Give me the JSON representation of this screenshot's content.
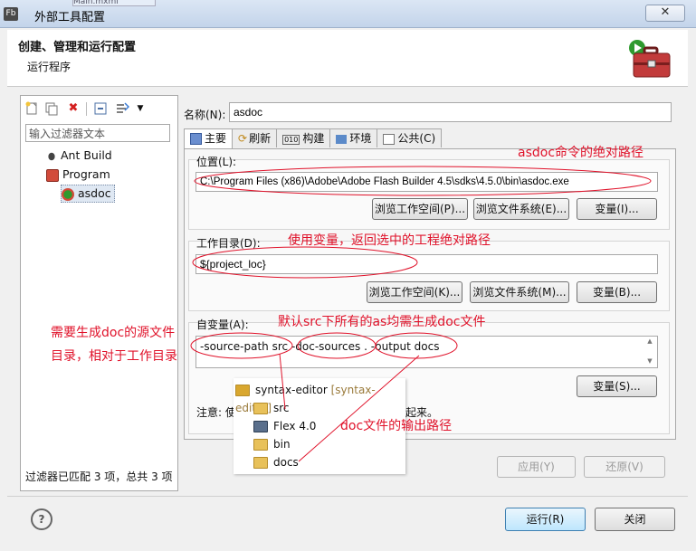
{
  "window": {
    "title": "外部工具配置",
    "app_icon": "Fb",
    "bg_tab": "Main.mxml",
    "close_glyph": "✕"
  },
  "banner": {
    "title": "创建、管理和运行配置",
    "subtitle": "运行程序",
    "icon": "toolbox-icon"
  },
  "left": {
    "filter_placeholder": "输入过滤器文本",
    "tree": [
      {
        "label": "Ant Build",
        "icon": "ant-icon"
      },
      {
        "label": "Program",
        "icon": "program-icon"
      },
      {
        "label": "asdoc",
        "icon": "program-config-icon",
        "selected": true
      }
    ],
    "status": "过滤器已匹配 3 项，总共 3 项"
  },
  "right": {
    "name_label": "名称(N):",
    "name_value": "asdoc",
    "tabs": [
      "主要",
      "刷新",
      "构建",
      "环境",
      "公共(C)"
    ],
    "location": {
      "label": "位置(L):",
      "value": "C:\\Program Files (x86)\\Adobe\\Adobe Flash Builder 4.5\\sdks\\4.5.0\\bin\\asdoc.exe",
      "btn_workspace": "浏览工作空间(P)...",
      "btn_filesystem": "浏览文件系统(E)...",
      "btn_variables": "变量(I)..."
    },
    "workdir": {
      "label": "工作目录(D):",
      "value": "${project_loc}",
      "btn_workspace": "浏览工作空间(K)...",
      "btn_filesystem": "浏览文件系统(M)...",
      "btn_variables": "变量(B)..."
    },
    "args": {
      "label": "自变量(A):",
      "value": "-source-path  src  -doc-sources  . -output docs",
      "btn_variables": "变量(S)...",
      "note_prefix": "注意: 使",
      "note_suffix": "起来。"
    },
    "apply": "应用(Y)",
    "revert": "还原(V)"
  },
  "popup": {
    "project": "syntax-editor",
    "project_tag": "[syntax-editor]",
    "items": [
      "src",
      "Flex 4.0",
      "bin",
      "docs"
    ]
  },
  "footer": {
    "run": "运行(R)",
    "close": "关闭"
  },
  "annotations": {
    "abs_path": "asdoc命令的绝对路径",
    "var_note": "使用变量，返回选中的工程绝对路径",
    "src_note": "默认src下所有的as均需生成doc文件",
    "left_note_1": "需要生成doc的源文件",
    "left_note_2": "目录，相对于工作目录",
    "output_note": "doc文件的输出路径",
    "color": "#e0122a"
  }
}
